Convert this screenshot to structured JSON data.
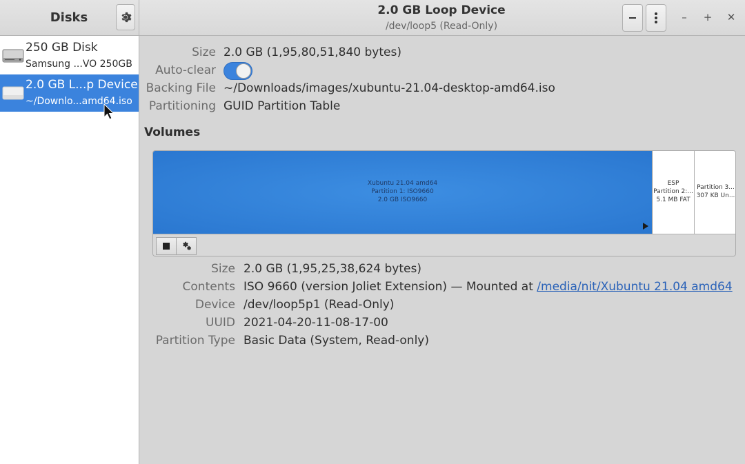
{
  "sidebar": {
    "title": "Disks",
    "items": [
      {
        "name": "250 GB Disk",
        "sub": "Samsung ...VO 250GB"
      },
      {
        "name": "2.0 GB L...p Device",
        "sub": "~/Downlo...amd64.iso"
      }
    ]
  },
  "header": {
    "title": "2.0 GB Loop Device",
    "subtitle": "/dev/loop5 (Read-Only)",
    "minimize_glyph": "–",
    "maximize_glyph": "+",
    "close_glyph": "✕"
  },
  "device": {
    "size_label": "Size",
    "size_value": "2.0 GB (1,95,80,51,840 bytes)",
    "autoclear_label": "Auto-clear",
    "autoclear_on": true,
    "backing_label": "Backing File",
    "backing_value": "~/Downloads/images/xubuntu-21.04-desktop-amd64.iso",
    "partitioning_label": "Partitioning",
    "partitioning_value": "GUID Partition Table"
  },
  "volumes": {
    "title": "Volumes",
    "partitions": [
      {
        "line1": "Xubuntu 21.04 amd64",
        "line2": "Partition 1: ISO9660",
        "line3": "2.0 GB ISO9660"
      },
      {
        "line1": "ESP",
        "line2": "Partition 2:...",
        "line3": "5.1 MB FAT"
      },
      {
        "line1": "Partition 3...",
        "line2": "307 KB Un..."
      }
    ]
  },
  "details": {
    "size_label": "Size",
    "size_value": "2.0 GB (1,95,25,38,624 bytes)",
    "contents_label": "Contents",
    "contents_prefix": "ISO 9660 (version Joliet Extension) — Mounted at",
    "contents_link": "/media/nit/Xubuntu 21.04 amd64",
    "device_label": "Device",
    "device_value": "/dev/loop5p1 (Read-Only)",
    "uuid_label": "UUID",
    "uuid_value": "2021-04-20-11-08-17-00",
    "ptype_label": "Partition Type",
    "ptype_value": "Basic Data (System, Read-only)"
  },
  "colors": {
    "accent": "#3b83dd",
    "link": "#2a62b8"
  }
}
